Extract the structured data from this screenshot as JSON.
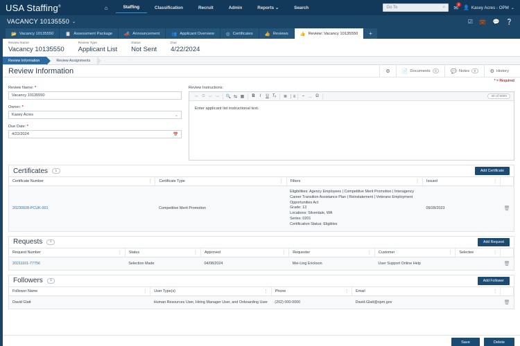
{
  "topnav": {
    "brand": "USA Staffing",
    "brand_sup": "®",
    "links": [
      {
        "label": "Staffing",
        "active": true
      },
      {
        "label": "Classification",
        "active": false
      },
      {
        "label": "Recruit",
        "active": false
      },
      {
        "label": "Admin",
        "active": false
      },
      {
        "label": "Reports",
        "active": false,
        "caret": "⌄"
      },
      {
        "label": "Search",
        "active": false
      }
    ],
    "home_icon": "home-icon",
    "goto_placeholder": "Go To",
    "search_icon": "search-icon",
    "envelope_icon": "envelope-icon",
    "notification_count": "2",
    "user_icon": "person-icon",
    "user_name": "Kasey Acres - OPM",
    "user_caret": "⌄"
  },
  "vacancy_bar": {
    "title": "VACANCY 10135550",
    "caret": "⌄",
    "icons": [
      "tasks-icon",
      "briefcase-icon",
      "chat-icon",
      "help-icon"
    ]
  },
  "tabs": [
    {
      "label": "Vacancy 10135550",
      "icon": "folder-icon",
      "active": false
    },
    {
      "label": "Assessment Package",
      "icon": "copy-icon",
      "active": false
    },
    {
      "label": "Announcement",
      "icon": "megaphone-icon",
      "active": false
    },
    {
      "label": "Applicant Overview",
      "icon": "people-icon",
      "active": false
    },
    {
      "label": "Certificates",
      "icon": "certificate-icon",
      "active": false
    },
    {
      "label": "Reviews",
      "icon": "thumbsup-icon",
      "active": false
    },
    {
      "label": "Review: Vacancy 10135550",
      "icon": "thumbsup-icon",
      "active": true
    }
  ],
  "tab_add_label": "+",
  "header_fields": [
    {
      "label": "Review Name",
      "value": "Vacancy 10135550"
    },
    {
      "label": "Review Type",
      "value": "Applicant List"
    },
    {
      "label": "Status",
      "value": "Not Sent"
    },
    {
      "label": "Due",
      "value": "4/22/2024"
    }
  ],
  "subtabs": [
    {
      "label": "Review Information",
      "active": true
    },
    {
      "label": "Review Assignments",
      "active": false
    }
  ],
  "page": {
    "title": "Review Information",
    "required_note": "* = Required",
    "tools": [
      {
        "label": "",
        "icon": "gear-icon",
        "count": null
      },
      {
        "label": "Documents",
        "icon": "document-icon",
        "count": "0"
      },
      {
        "label": "Notes",
        "icon": "note-icon",
        "count": "0"
      },
      {
        "label": "History",
        "icon": "history-icon",
        "count": null
      }
    ]
  },
  "form": {
    "review_name": {
      "label": "Review Name:",
      "required": "*",
      "value": "Vacancy 10135550"
    },
    "owner": {
      "label": "Owner:",
      "required": "*",
      "value": "Kasey Acres",
      "caret": "⌄"
    },
    "due_date": {
      "label": "Due Date:",
      "required": "*",
      "value": "4/22/2024",
      "icon": "calendar-icon"
    },
    "instructions": {
      "label": "Review Instructions:",
      "body": "Enter applicant list instructional text.",
      "char_count": "40 of 5000",
      "toolbar": [
        {
          "group": 1,
          "icons": [
            "cut-icon",
            "copy-icon",
            "undo-icon",
            "redo-icon"
          ],
          "glyphs": [
            "✂",
            "⎘",
            "↩",
            "↪"
          ],
          "dim": true
        },
        {
          "group": 2,
          "icons": [
            "find-icon",
            "replace-icon",
            "select-all-icon"
          ],
          "glyphs": [
            "🔍",
            "⇄",
            "▤"
          ],
          "dim": false
        },
        {
          "group": 3,
          "icons": [
            "bold-icon",
            "italic-icon",
            "underline-icon",
            "remove-format-icon"
          ],
          "glyphs": [
            "B",
            "I",
            "U",
            "Tx"
          ],
          "dim": false
        },
        {
          "group": 4,
          "icons": [
            "ordered-list-icon",
            "unordered-list-icon"
          ],
          "glyphs": [
            "≔",
            "⋮≡"
          ],
          "dim": false
        },
        {
          "group": 5,
          "icons": [
            "link-icon",
            "unlink-icon",
            "special-char-icon"
          ],
          "glyphs": [
            "⛓",
            "⛓",
            "Ω"
          ],
          "dim": false
        }
      ]
    }
  },
  "certificates": {
    "title": "Certificates",
    "count": "1",
    "add_label": "Add Certificate",
    "columns": [
      "Certificate Number",
      "Certificate Type",
      "Filters",
      "Issued"
    ],
    "rows": [
      {
        "number": "20230928-PCUK-001",
        "type": "Competitive Merit Promotion",
        "filters": "Eligibilities: Agency Employees | Competitive Merit Promotion | Interagency Career Transition Assistance Plan | Reinstatement | Veterans Employment Opportunities Act\nGrade: 13\nLocations: Silverdale, WA\nSeries: 0201\nCertification Status: Eligibles",
        "issued": "09/28/2023",
        "delete_icon": "trash-icon"
      }
    ]
  },
  "requests": {
    "title": "Requests",
    "count": "1",
    "add_label": "Add Request",
    "columns": [
      "Request Number",
      "Status",
      "Approved",
      "Requester",
      "Customer",
      "Selectee"
    ],
    "rows": [
      {
        "number": "20211101-77756",
        "status": "Selection Made",
        "approved": "04/08/2024",
        "requester": "Mei-Ling Erickson",
        "customer": "User Support Online Help",
        "selectee": "",
        "delete_icon": "trash-icon"
      }
    ]
  },
  "followers": {
    "title": "Followers",
    "count": "1",
    "add_label": "Add Follower",
    "columns": [
      "Follower Name",
      "User Type(s)",
      "Phone",
      "Email"
    ],
    "rows": [
      {
        "name": "David Glatt",
        "user_types": "Human Resources User, Hiring Manager User, and Onboarding User",
        "phone": "(202) 000-0000",
        "email": "David.Glatt@opm.gov",
        "delete_icon": "trash-icon"
      }
    ]
  },
  "footer": {
    "save_label": "Save",
    "delete_label": "Delete"
  },
  "colors": {
    "navy_dark": "#12385a",
    "navy": "#1b4668",
    "tab_blue": "#24567c",
    "accent_blue": "#2d6a9f",
    "button_navy": "#1b4a73",
    "link_blue": "#2f6fad",
    "required_red": "#c0392b",
    "badge_red": "#cc2b28"
  }
}
